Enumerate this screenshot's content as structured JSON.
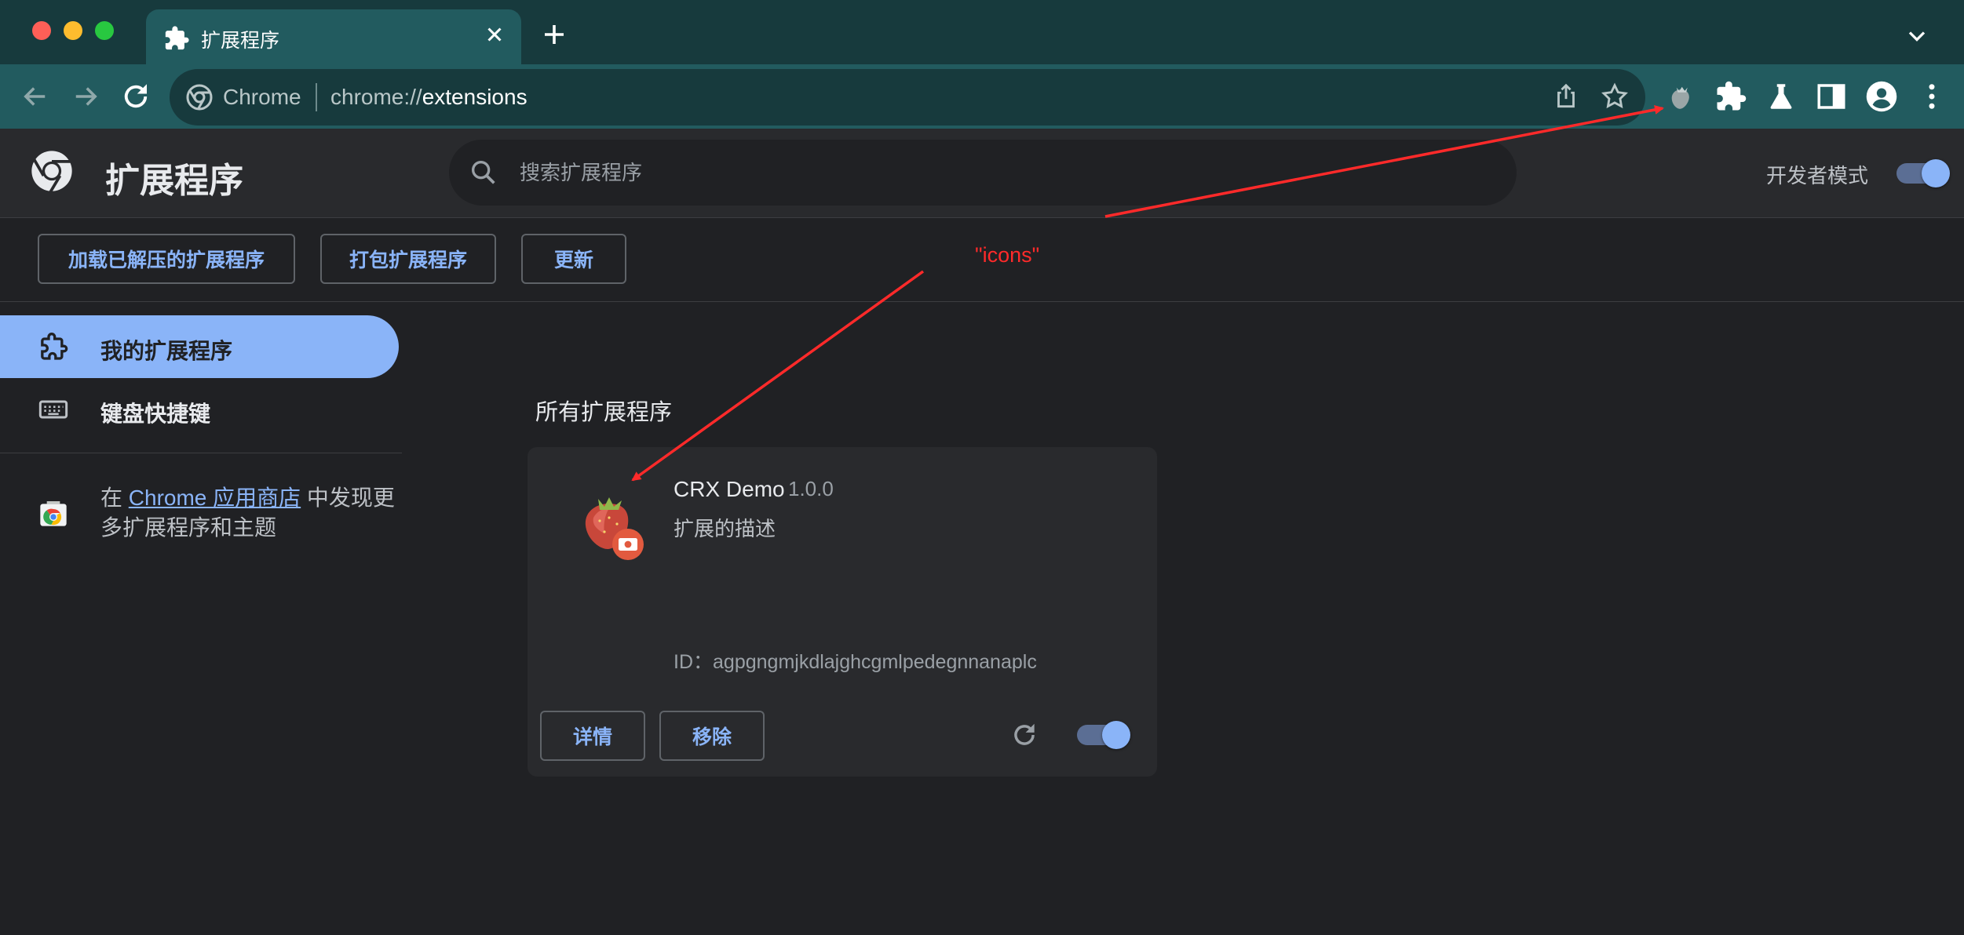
{
  "browser": {
    "tab": {
      "title": "扩展程序"
    },
    "omnibox": {
      "site": "Chrome",
      "url_scheme": "chrome://",
      "url_path": "extensions"
    }
  },
  "header": {
    "title": "扩展程序",
    "search_placeholder": "搜索扩展程序",
    "dev_mode_label": "开发者模式",
    "dev_mode_on": true
  },
  "actions": {
    "load_unpacked": "加载已解压的扩展程序",
    "pack": "打包扩展程序",
    "update": "更新"
  },
  "sidebar": {
    "items": [
      {
        "label": "我的扩展程序",
        "icon": "extensions-icon",
        "active": true
      },
      {
        "label": "键盘快捷键",
        "icon": "keyboard-icon",
        "active": false
      }
    ],
    "webstore": {
      "prefix": "在 ",
      "link": "Chrome 应用商店",
      "suffix": " 中发现更多扩展程序和主题"
    }
  },
  "main": {
    "section_title": "所有扩展程序",
    "extension": {
      "name": "CRX Demo",
      "version": "1.0.0",
      "description": "扩展的描述",
      "id_label": "ID：",
      "id": "agpgngmjkdlajghcgmlpedegnnanaplc",
      "details_button": "详情",
      "remove_button": "移除",
      "enabled": true
    }
  },
  "annotation": {
    "label": "\"icons\"",
    "color": "#ff2a2a"
  },
  "colors": {
    "accent": "#8ab4f8",
    "frame": "#225b5f",
    "frame_dark": "#173a3d",
    "background": "#202124"
  }
}
